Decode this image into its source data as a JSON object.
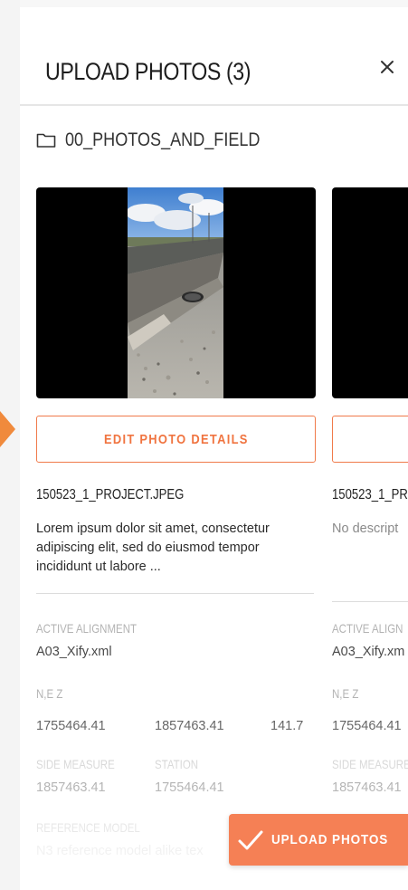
{
  "header": {
    "title": "UPLOAD PHOTOS (3)",
    "close_icon": "close-icon"
  },
  "folder": {
    "icon": "folder-icon",
    "name": "00_PHOTOS_AND_FIELD"
  },
  "colors": {
    "accent": "#f58055",
    "accent_text": "#f07440",
    "pointer": "#f08a3c"
  },
  "cards": [
    {
      "edit_label": "EDIT PHOTO DETAILS",
      "filename": "150523_1_PROJECT.JPEG",
      "description": "Lorem ipsum dolor sit amet, consectetur adipiscing elit, sed do eiusmod tempor incididunt ut labore ...",
      "active_alignment_label": "ACTIVE  ALIGNMENT",
      "active_alignment_value": "A03_Xify.xml",
      "nez_label": "N,E Z",
      "n_value": "1755464.41",
      "e_value": "1857463.41",
      "z_value": "141.7",
      "side_measure_label": "SIDE MEASURE",
      "side_measure_value": "1857463.41",
      "station_label": "STATION",
      "station_value": "1755464.41",
      "reference_model_label": "REFERENCE MODEL",
      "reference_model_value": "N3 reference model alike tex"
    },
    {
      "edit_label": "E",
      "filename": "150523_1_PRC",
      "description": "No descript",
      "active_alignment_label": "ACTIVE  ALIGN",
      "active_alignment_value": "A03_Xify.xm",
      "nez_label": "N,E Z",
      "n_value": "1755464.41",
      "side_measure_label": "SIDE MEASURE",
      "side_measure_value": "1857463.41"
    }
  ],
  "upload_button": {
    "label": "UPLOAD PHOTOS",
    "icon": "check-icon"
  }
}
